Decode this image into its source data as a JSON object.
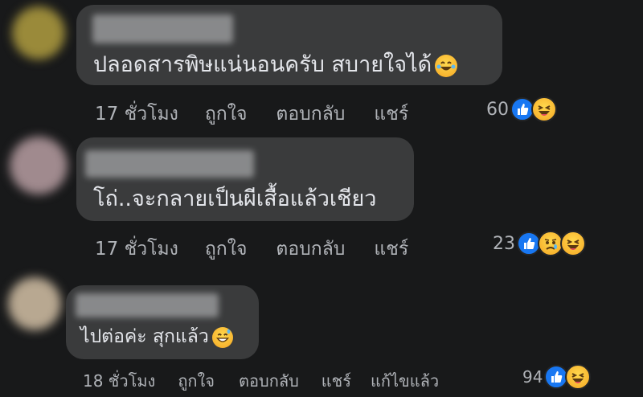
{
  "comments": [
    {
      "text": "ปลอดสารพิษแน่นอนครับ สบายใจได้",
      "time": "17 ชั่วโมง",
      "like": "ถูกใจ",
      "reply": "ตอบกลับ",
      "share": "แชร์",
      "edited": "",
      "reaction_count": "60",
      "reactions": [
        "like-icon",
        "laughing-icon"
      ]
    },
    {
      "text": "โถ่..จะกลายเป็นผีเสื้อแล้วเชียว",
      "time": "17 ชั่วโมง",
      "like": "ถูกใจ",
      "reply": "ตอบกลับ",
      "share": "แชร์",
      "edited": "",
      "reaction_count": "23",
      "reactions": [
        "like-icon",
        "sad-icon",
        "laughing-icon"
      ]
    },
    {
      "text": "ไปต่อค่ะ สุกแล้ว",
      "time": "18 ชั่วโมง",
      "like": "ถูกใจ",
      "reply": "ตอบกลับ",
      "share": "แชร์",
      "edited": "แก้ไขแล้ว",
      "reaction_count": "94",
      "reactions": [
        "like-icon",
        "laughing-icon"
      ]
    }
  ],
  "colors": {
    "background": "#18191a",
    "bubble": "#3a3b3c",
    "text": "#e4e6eb",
    "meta": "#b0b3b8",
    "like_blue": "#1877f2"
  }
}
